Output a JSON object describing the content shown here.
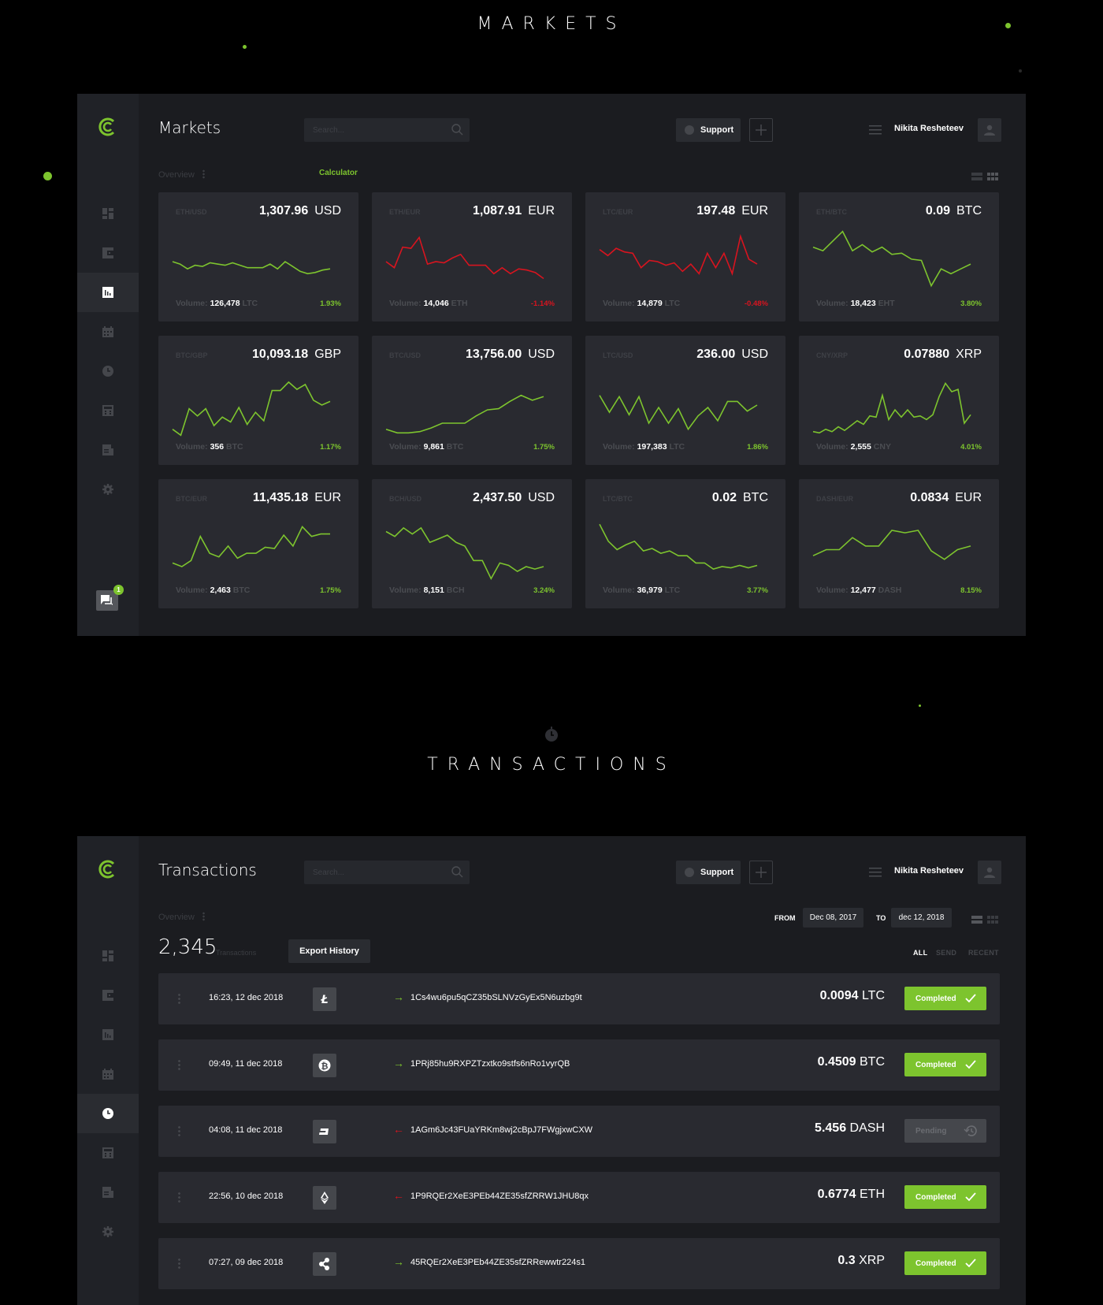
{
  "colors": {
    "accent": "#7dc42e",
    "negative": "#d8141f",
    "background": "#000000",
    "panel": "#1b1c20",
    "card": "#292a30"
  },
  "sections": {
    "markets_title": "MARKETS",
    "transactions_title": "TRANSACTIONS"
  },
  "header": {
    "search_placeholder": "Search...",
    "support_label": "Support",
    "user_name": "Nikita Resheteev"
  },
  "sidebar": {
    "items": [
      {
        "icon": "dashboard-icon"
      },
      {
        "icon": "wallet-icon"
      },
      {
        "icon": "markets-chart-icon"
      },
      {
        "icon": "calendar-icon"
      },
      {
        "icon": "clock-icon"
      },
      {
        "icon": "calculator-icon"
      },
      {
        "icon": "document-icon"
      },
      {
        "icon": "gear-icon"
      }
    ],
    "chat_badge": "1"
  },
  "markets": {
    "page_title": "Markets",
    "overview_label": "Overview",
    "calculator_label": "Calculator",
    "volume_label": "Volume:",
    "cards": [
      {
        "pair": "ETH/USD",
        "price": "1,307.96",
        "currency": "USD",
        "volume": "126,478",
        "volume_unit": "LTC",
        "change": "1.93%",
        "trend": "up",
        "series": [
          50,
          48,
          44,
          47,
          46,
          49,
          48,
          47,
          49,
          47,
          45,
          45,
          45,
          48,
          44,
          50,
          46,
          42,
          40,
          41,
          43,
          44
        ]
      },
      {
        "pair": "ETH/EUR",
        "price": "1,087.91",
        "currency": "EUR",
        "volume": "14,046",
        "volume_unit": "ETH",
        "change": "-1.14%",
        "trend": "down",
        "series": [
          50,
          45,
          62,
          61,
          70,
          48,
          50,
          49,
          53,
          56,
          47,
          47,
          47,
          40,
          45,
          40,
          44,
          43,
          41,
          36
        ]
      },
      {
        "pair": "LTC/EUR",
        "price": "197.48",
        "currency": "EUR",
        "volume": "14,879",
        "volume_unit": "LTC",
        "change": "-0.48%",
        "trend": "down",
        "series": [
          60,
          55,
          61,
          58,
          57,
          45,
          51,
          50,
          47,
          49,
          42,
          48,
          40,
          57,
          45,
          57,
          40,
          71,
          52,
          48
        ]
      },
      {
        "pair": "ETH/BTC",
        "price": "0.09",
        "currency": "BTC",
        "volume": "18,423",
        "volume_unit": "EHT",
        "change": "3.80%",
        "trend": "up",
        "series": [
          62,
          59,
          67,
          75,
          59,
          64,
          58,
          62,
          56,
          57,
          52,
          51,
          30,
          44,
          40,
          44,
          48
        ]
      },
      {
        "pair": "BTC/GBP",
        "price": "10,093.18",
        "currency": "GBP",
        "volume": "356",
        "volume_unit": "BTC",
        "change": "1.17%",
        "trend": "up",
        "series": [
          30,
          25,
          47,
          41,
          47,
          33,
          40,
          36,
          48,
          34,
          44,
          37,
          62,
          62,
          69,
          63,
          67,
          54,
          50,
          53
        ]
      },
      {
        "pair": "BTC/USD",
        "price": "13,756.00",
        "currency": "USD",
        "volume": "9,861",
        "volume_unit": "BTC",
        "change": "1.75%",
        "trend": "up",
        "series": [
          30,
          27,
          27,
          28,
          31,
          35,
          35,
          35,
          41,
          46,
          47,
          53,
          58,
          54,
          57
        ]
      },
      {
        "pair": "LTC/USD",
        "price": "236.00",
        "currency": "USD",
        "volume": "197,383",
        "volume_unit": "LTC",
        "change": "1.86%",
        "trend": "up",
        "series": [
          58,
          44,
          57,
          42,
          57,
          35,
          48,
          35,
          47,
          30,
          41,
          48,
          37,
          53,
          53,
          45,
          50
        ]
      },
      {
        "pair": "CNY/XRP",
        "price": "0.07880",
        "currency": "XRP",
        "volume": "2,555",
        "volume_unit": "CNY",
        "change": "4.01%",
        "trend": "up",
        "series": [
          28,
          27,
          30,
          28,
          32,
          29,
          33,
          37,
          34,
          41,
          40,
          58,
          38,
          46,
          40,
          46,
          40,
          41,
          38,
          42,
          57,
          68,
          61,
          63,
          35,
          42
        ]
      },
      {
        "pair": "BTC/EUR",
        "price": "11,435.18",
        "currency": "EUR",
        "volume": "2,463",
        "volume_unit": "BTC",
        "change": "1.75%",
        "trend": "up",
        "series": [
          38,
          35,
          40,
          60,
          46,
          43,
          52,
          42,
          46,
          46,
          51,
          50,
          61,
          52,
          68,
          60,
          62,
          62
        ]
      },
      {
        "pair": "BCH/USD",
        "price": "2,437.50",
        "currency": "USD",
        "volume": "8,151",
        "volume_unit": "BCH",
        "change": "3.24%",
        "trend": "up",
        "series": [
          64,
          60,
          67,
          62,
          67,
          55,
          58,
          61,
          55,
          52,
          40,
          40,
          25,
          38,
          36,
          31,
          35,
          33,
          35
        ]
      },
      {
        "pair": "LTC/BTC",
        "price": "0.02",
        "currency": "BTC",
        "volume": "36,979",
        "volume_unit": "LTC",
        "change": "3.77%",
        "trend": "up",
        "series": [
          70,
          56,
          49,
          53,
          56,
          48,
          50,
          46,
          48,
          44,
          44,
          38,
          38,
          33,
          35,
          34,
          36,
          34,
          36
        ]
      },
      {
        "pair": "DASH/EUR",
        "price": "0.0834",
        "currency": "EUR",
        "volume": "12,477",
        "volume_unit": "DASH",
        "change": "8.15%",
        "trend": "up",
        "series": [
          44,
          49,
          49,
          59,
          52,
          52,
          65,
          63,
          65,
          48,
          41,
          49,
          52
        ]
      }
    ]
  },
  "transactions": {
    "page_title": "Transactions",
    "overview_label": "Overview",
    "count": "2,345",
    "count_label": "Transactions",
    "export_label": "Export History",
    "from_label": "FROM",
    "from_date": "Dec 08, 2017",
    "to_label": "TO",
    "to_date": "dec 12, 2018",
    "filters": [
      "ALL",
      "SEND",
      "RECENT"
    ],
    "active_filter": "ALL",
    "rows": [
      {
        "time": "16:23, 12 dec 2018",
        "coin": "litecoin-icon",
        "direction": "out",
        "address": "1Cs4wu6pu5qCZ35bSLNVzGyEx5N6uzbg9t",
        "amount": "0.0094",
        "unit": "LTC",
        "status": "Completed"
      },
      {
        "time": "09:49, 11 dec 2018",
        "coin": "bitcoin-icon",
        "direction": "out",
        "address": "1PRj85hu9RXPZTzxtko9stfs6nRo1vyrQB",
        "amount": "0.4509",
        "unit": "BTC",
        "status": "Completed"
      },
      {
        "time": "04:08, 11 dec 2018",
        "coin": "dash-icon",
        "direction": "in",
        "address": "1AGm6Jc43FUaYRKm8wj2cBpJ7FWgjxwCXW",
        "amount": "5.456",
        "unit": "DASH",
        "status": "Pending"
      },
      {
        "time": "22:56, 10 dec 2018",
        "coin": "ethereum-icon",
        "direction": "in",
        "address": "1P9RQEr2XeE3PEb44ZE35sfZRRW1JHU8qx",
        "amount": "0.6774",
        "unit": "ETH",
        "status": "Completed"
      },
      {
        "time": "07:27, 09 dec 2018",
        "coin": "ripple-icon",
        "direction": "out",
        "address": "45RQEr2XeE3PEb44ZE35sfZRRewwtr224s1",
        "amount": "0.3",
        "unit": "XRP",
        "status": "Completed"
      }
    ]
  }
}
